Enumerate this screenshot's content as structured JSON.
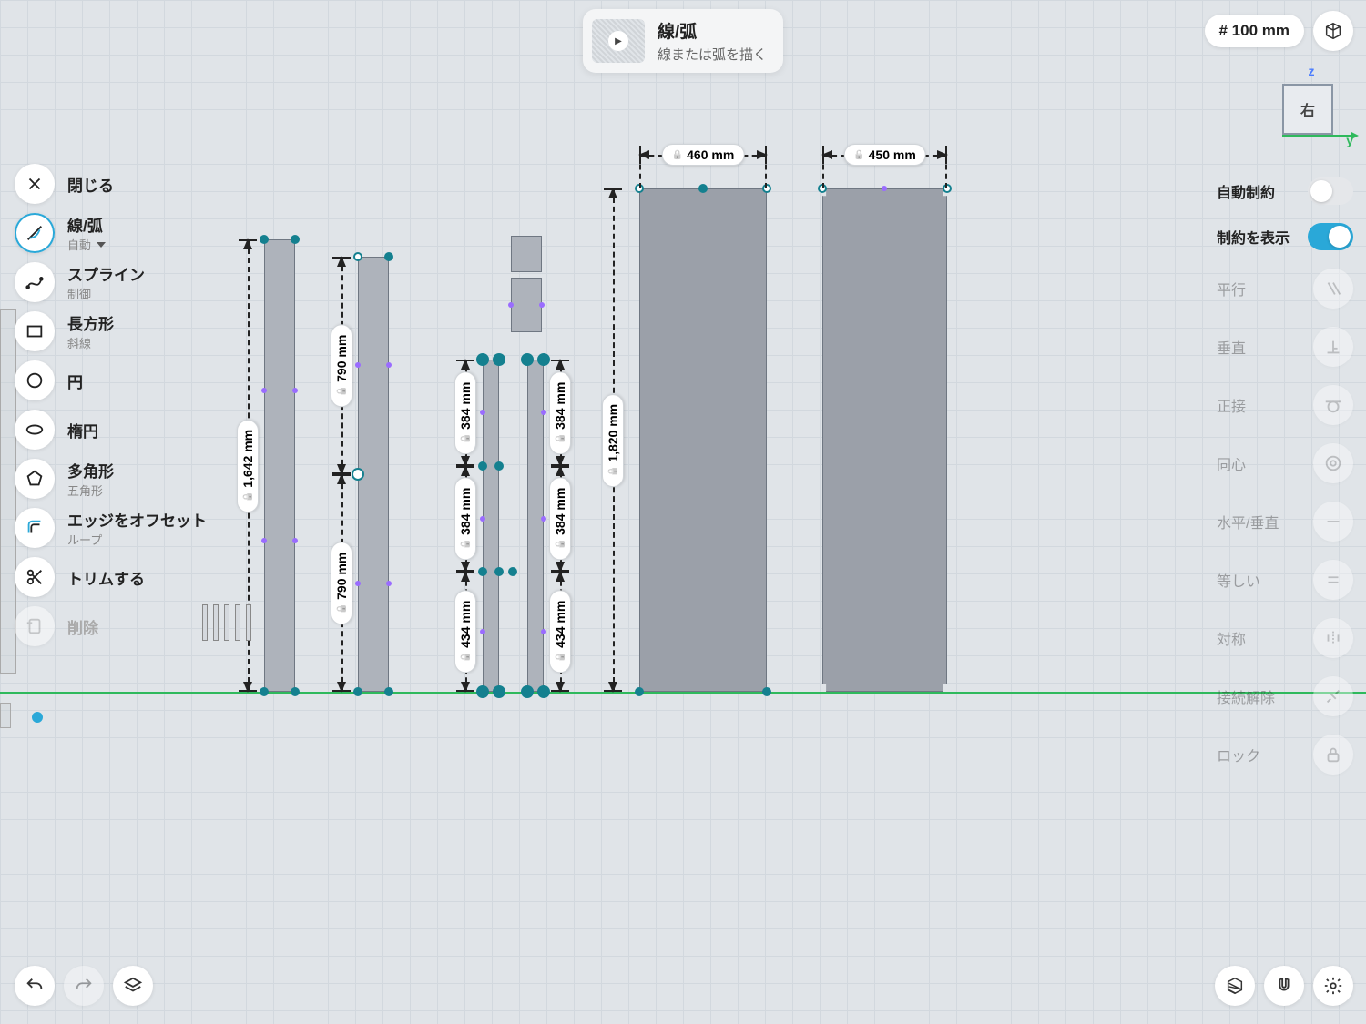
{
  "tooltip": {
    "title": "線/弧",
    "subtitle": "線または弧を描く"
  },
  "grid_input": {
    "value": "# 100 mm"
  },
  "axis": {
    "z": "z",
    "y": "y",
    "face": "右"
  },
  "left_tools": [
    {
      "id": "close",
      "label": "閉じる",
      "sub": null
    },
    {
      "id": "line-arc",
      "label": "線/弧",
      "sub": "自動",
      "active": true,
      "caret": true
    },
    {
      "id": "spline",
      "label": "スプライン",
      "sub": "制御"
    },
    {
      "id": "rectangle",
      "label": "長方形",
      "sub": "斜線"
    },
    {
      "id": "circle",
      "label": "円",
      "sub": null
    },
    {
      "id": "ellipse",
      "label": "楕円",
      "sub": null
    },
    {
      "id": "polygon",
      "label": "多角形",
      "sub": "五角形"
    },
    {
      "id": "offset",
      "label": "エッジをオフセット",
      "sub": "ループ"
    },
    {
      "id": "trim",
      "label": "トリムする",
      "sub": null
    },
    {
      "id": "delete",
      "label": "削除",
      "sub": null,
      "disabled": true
    }
  ],
  "toggles": {
    "auto_constraint": {
      "label": "自動制約",
      "on": false
    },
    "show_constraint": {
      "label": "制約を表示",
      "on": true
    }
  },
  "constraints": [
    {
      "id": "parallel",
      "label": "平行"
    },
    {
      "id": "perpendicular",
      "label": "垂直"
    },
    {
      "id": "tangent",
      "label": "正接"
    },
    {
      "id": "concentric",
      "label": "同心"
    },
    {
      "id": "hv",
      "label": "水平/垂直"
    },
    {
      "id": "equal",
      "label": "等しい"
    },
    {
      "id": "symmetric",
      "label": "対称"
    },
    {
      "id": "disconnect",
      "label": "接続解除"
    },
    {
      "id": "lock",
      "label": "ロック"
    }
  ],
  "dimensions": {
    "h460": "460 mm",
    "h450": "450 mm",
    "v1820": "1,820 mm",
    "v1642": "1,642 mm",
    "v790a": "790 mm",
    "v790b": "790 mm",
    "v384a": "384 mm",
    "v384b": "384 mm",
    "v384c": "384 mm",
    "v384d": "384 mm",
    "v434a": "434 mm",
    "v434b": "434 mm"
  }
}
